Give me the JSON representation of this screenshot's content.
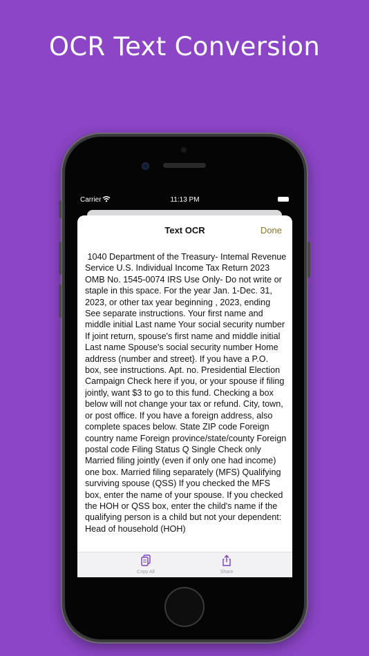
{
  "headline": "OCR Text Conversion",
  "status_bar": {
    "carrier": "Carrier",
    "time": "11:13 PM",
    "wifi_icon": "wifi-icon",
    "battery_icon": "battery-icon"
  },
  "sheet": {
    "title": "Text OCR",
    "done_label": "Done",
    "ocr_text": " 1040 Department of the Treasury- Intemal Revenue Service U.S. Individual Income Tax Return 2023 OMB No. 1545-0074 IRS Use Only- Do not write or staple in this space. For the year Jan. 1-Dec. 31, 2023, or other tax year beginning , 2023, ending See separate instructions. Your first name and middle initial Last name Your social security number If joint return, spouse's first name and middle initial Last name Spouse's social security number Home address (number and street}. If you have a P.O. box, see instructions. Apt. no. Presidential Election Campaign Check here if you, or your spouse if filing jointly, want $3 to go to this fund. Checking a box below will not change your tax or refund. City, town, or post office. If you have a foreign address, also complete spaces below. State ZIP code Foreign country name Foreign province/state/county Foreign postal code Filing Status Q Single Check only Married filing jointly (even if only one had income) one box. Married filing separately (MFS) Qualifying surviving spouse (QSS) If you checked the MFS box, enter the name of your spouse. If you checked the HOH or QSS box, enter the child's name if the qualifying person is a child but not your dependent: Head of household (HOH)"
  },
  "toolbar": {
    "copy_all_label": "Copy All",
    "copy_icon": "copy-icon",
    "share_label": "Share",
    "share_icon": "share-icon"
  },
  "colors": {
    "background": "#8b45c6",
    "done": "#8c7425",
    "toolbar_icon": "#7b3fc0"
  }
}
